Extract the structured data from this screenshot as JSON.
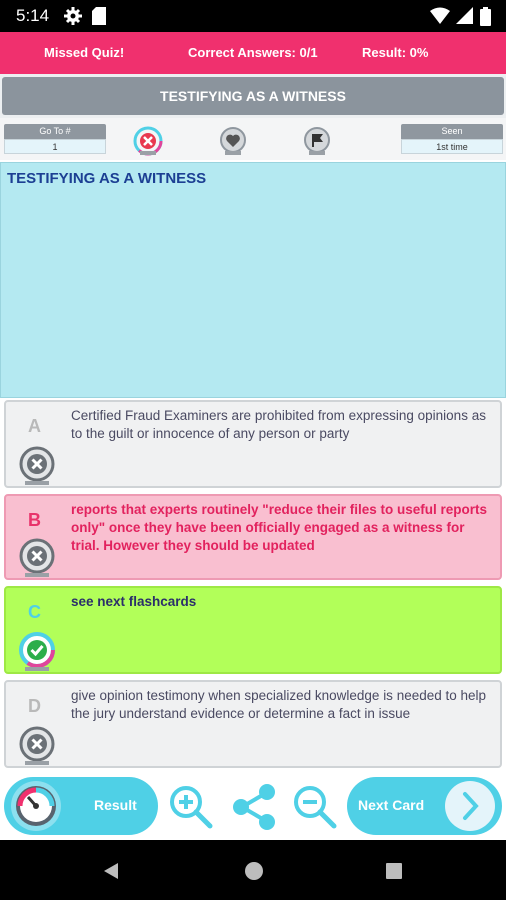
{
  "status_bar": {
    "time": "5:14"
  },
  "top_bar": {
    "missed_quiz": "Missed Quiz!",
    "correct_answers": "Correct Answers: 0/1",
    "result": "Result: 0%"
  },
  "title": "TESTIFYING AS A WITNESS",
  "toolbar": {
    "goto_label": "Go To #",
    "goto_value": "1",
    "seen_label": "Seen",
    "seen_value": "1st time"
  },
  "question": {
    "text": "TESTIFYING AS A WITNESS"
  },
  "options": [
    {
      "letter": "A",
      "text": "Certified Fraud Examiners are prohibited from expressing opinions as to the guilt or innocence of any person or party",
      "status": "wrong"
    },
    {
      "letter": "B",
      "text": "reports that experts routinely \"reduce their files to useful reports only\" once they have been officially engaged as a witness for trial. However they should be updated",
      "status": "selected-wrong"
    },
    {
      "letter": "C",
      "text": "see next flashcards",
      "status": "correct"
    },
    {
      "letter": "D",
      "text": " give opinion testimony when specialized knowledge is needed to help the jury understand evidence or determine a fact in issue",
      "status": "wrong"
    }
  ],
  "bottom_bar": {
    "result_label": "Result",
    "next_label": "Next Card"
  },
  "colors": {
    "accent_pink": "#f0306e",
    "cyan": "#4fd0e6",
    "correct_green": "#b2ff59",
    "selected_pink": "#f9bfd0",
    "question_bg": "#b4e9f1"
  }
}
